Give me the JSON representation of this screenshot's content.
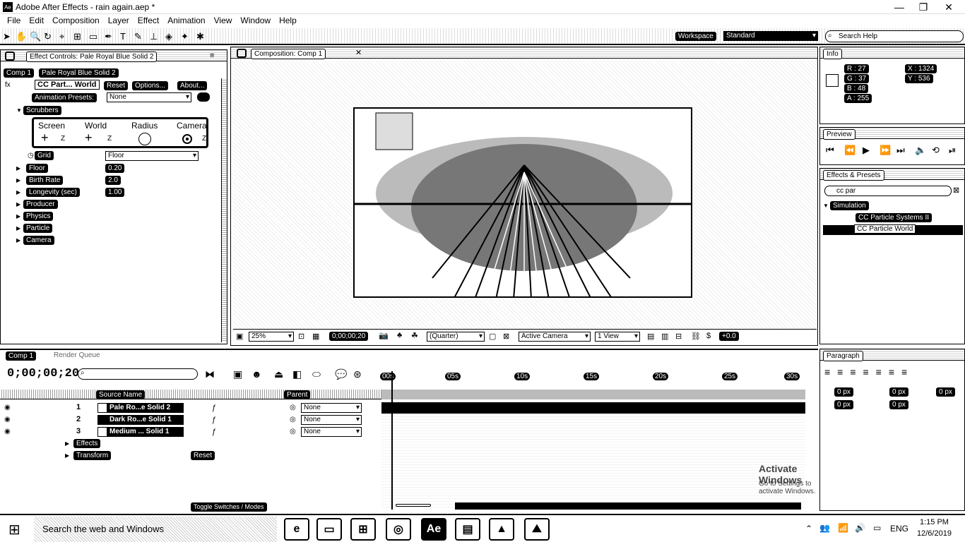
{
  "window": {
    "title": "Adobe After Effects - rain again.aep *",
    "minimize": "—",
    "maximize": "❐",
    "close": "✕"
  },
  "menu": [
    "File",
    "Edit",
    "Composition",
    "Layer",
    "Effect",
    "Animation",
    "View",
    "Window",
    "Help"
  ],
  "toolbar": {
    "workspace_label": "Workspace",
    "workspace_value": "Standard",
    "search_placeholder": "Search Help"
  },
  "effect_controls": {
    "tab": "Effect Controls: Pale Royal Blue Solid 2",
    "breadcrumb_comp": "Comp 1",
    "breadcrumb_layer": "Pale Royal Blue Solid 2",
    "effect_name": "CC Part... World",
    "reset": "Reset",
    "options": "Options...",
    "about": "About...",
    "animation_presets_label": "Animation Presets:",
    "animation_presets_value": "None",
    "scrubbers": "Scrubbers",
    "scrubber_labels": [
      "Screen",
      "World",
      "Radius",
      "Camera"
    ],
    "scrubber_z": "Z",
    "grid_label": "Grid",
    "grid_value": "Floor",
    "floor_label": "Floor",
    "floor_value": "0.20",
    "birth_rate_label": "Birth Rate",
    "birth_rate_value": "2.0",
    "longevity_label": "Longevity (sec)",
    "longevity_value": "1.00",
    "groups": [
      "Producer",
      "Physics",
      "Particle",
      "Camera"
    ]
  },
  "composition": {
    "tab": "Composition: Comp 1",
    "comp_chip": "Comp 1"
  },
  "viewer_bar": {
    "zoom": "25%",
    "timecode": "0;00;00;20",
    "resolution": "(Quarter)",
    "camera": "Active Camera",
    "view": "1 View",
    "exposure": "+0.0"
  },
  "info": {
    "tab": "Info",
    "r": "R : 27",
    "g": "G : 37",
    "b": "B : 48",
    "a": "A : 255",
    "x": "X : 1324",
    "y": "Y : 536"
  },
  "preview": {
    "tab": "Preview"
  },
  "effects_presets": {
    "tab": "Effects & Presets",
    "search_value": "cc par",
    "category": "Simulation",
    "item1": "CC Particle Systems II",
    "item2": "CC Particle World"
  },
  "paragraph": {
    "tab": "Paragraph",
    "v1": "0 px",
    "v2": "0 px",
    "v3": "0 px",
    "v4": "0 px",
    "v5": "0 px"
  },
  "timeline": {
    "tab": "Comp 1",
    "tab2": "Render Queue",
    "timecode": "0;00;00;20",
    "columns": {
      "source_name": "Source Name",
      "parent": "Parent"
    },
    "ruler": [
      "00s",
      "05s",
      "10s",
      "15s",
      "20s",
      "25s",
      "30s"
    ],
    "layers": [
      {
        "num": "1",
        "name": "Pale Ro...e Solid 2",
        "parent": "None"
      },
      {
        "num": "2",
        "name": "Dark Ro...e Solid 1",
        "parent": "None"
      },
      {
        "num": "3",
        "name": "Medium ... Solid 1",
        "parent": "None"
      }
    ],
    "effects": "Effects",
    "transform": "Transform",
    "reset": "Reset",
    "toggle": "Toggle Switches / Modes"
  },
  "watermark": {
    "title": "Activate Windows",
    "subtitle": "Go to Settings to activate Windows."
  },
  "taskbar": {
    "search": "Search the web and Windows",
    "lang": "ENG",
    "time": "1:15 PM",
    "date": "12/6/2019"
  }
}
